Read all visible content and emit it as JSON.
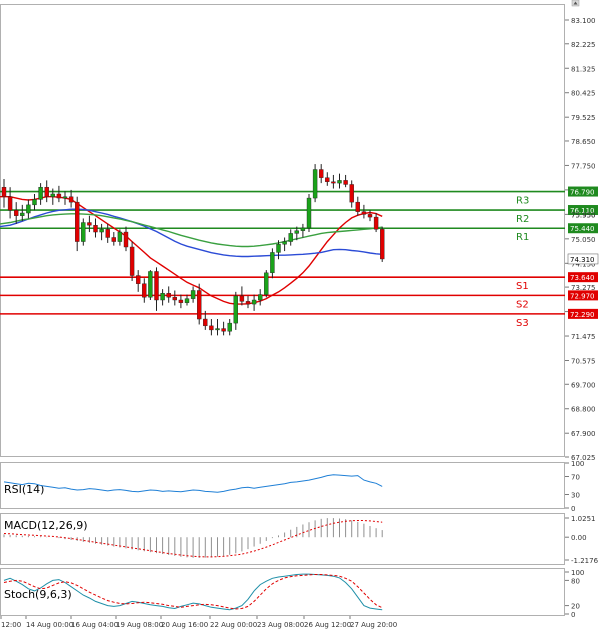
{
  "chart_data": [
    {
      "type": "candlestick",
      "panel": "price",
      "y_axis_ticks": [
        "83.100",
        "82.225",
        "81.325",
        "80.425",
        "79.525",
        "78.650",
        "77.750",
        "76.850",
        "75.950",
        "75.050",
        "74.150",
        "73.275",
        "72.375",
        "71.475",
        "70.575",
        "69.700",
        "68.800",
        "67.900",
        "67.025"
      ],
      "ylim": [
        67.025,
        83.1
      ],
      "x_tick_labels": [
        "12:00",
        "14 Aug 00:00",
        "16 Aug 04:00",
        "19 Aug 08:00",
        "20 Aug 16:00",
        "22 Aug 00:00",
        "23 Aug 08:00",
        "26 Aug 12:00",
        "27 Aug 20:00"
      ],
      "candles": [
        {
          "o": 76.95,
          "h": 77.25,
          "l": 76.2,
          "c": 76.6
        },
        {
          "o": 76.6,
          "h": 76.95,
          "l": 75.8,
          "c": 76.1
        },
        {
          "o": 76.1,
          "h": 76.4,
          "l": 75.6,
          "c": 75.9
        },
        {
          "o": 75.9,
          "h": 76.3,
          "l": 75.7,
          "c": 76.0
        },
        {
          "o": 76.0,
          "h": 76.5,
          "l": 75.8,
          "c": 76.3
        },
        {
          "o": 76.3,
          "h": 76.7,
          "l": 76.1,
          "c": 76.5
        },
        {
          "o": 76.5,
          "h": 77.1,
          "l": 76.3,
          "c": 76.95
        },
        {
          "o": 76.95,
          "h": 77.2,
          "l": 76.4,
          "c": 76.6
        },
        {
          "o": 76.6,
          "h": 76.9,
          "l": 76.3,
          "c": 76.7
        },
        {
          "o": 76.7,
          "h": 77.0,
          "l": 76.4,
          "c": 76.55
        },
        {
          "o": 76.55,
          "h": 76.8,
          "l": 76.3,
          "c": 76.6
        },
        {
          "o": 76.6,
          "h": 76.85,
          "l": 76.2,
          "c": 76.4
        },
        {
          "o": 76.4,
          "h": 76.6,
          "l": 74.6,
          "c": 74.95
        },
        {
          "o": 74.95,
          "h": 75.8,
          "l": 74.8,
          "c": 75.65
        },
        {
          "o": 75.65,
          "h": 75.9,
          "l": 75.3,
          "c": 75.55
        },
        {
          "o": 75.55,
          "h": 75.8,
          "l": 75.1,
          "c": 75.3
        },
        {
          "o": 75.3,
          "h": 75.6,
          "l": 75.0,
          "c": 75.4
        },
        {
          "o": 75.4,
          "h": 75.6,
          "l": 74.9,
          "c": 75.1
        },
        {
          "o": 75.1,
          "h": 75.3,
          "l": 74.8,
          "c": 74.95
        },
        {
          "o": 74.95,
          "h": 75.4,
          "l": 74.8,
          "c": 75.3
        },
        {
          "o": 75.3,
          "h": 75.5,
          "l": 74.6,
          "c": 74.75
        },
        {
          "o": 74.75,
          "h": 74.95,
          "l": 73.5,
          "c": 73.7
        },
        {
          "o": 73.7,
          "h": 73.9,
          "l": 73.1,
          "c": 73.4
        },
        {
          "o": 73.4,
          "h": 73.6,
          "l": 72.7,
          "c": 72.9
        },
        {
          "o": 72.9,
          "h": 73.9,
          "l": 72.8,
          "c": 73.85
        },
        {
          "o": 73.85,
          "h": 74.0,
          "l": 72.4,
          "c": 72.8
        },
        {
          "o": 72.8,
          "h": 73.2,
          "l": 72.6,
          "c": 73.05
        },
        {
          "o": 73.05,
          "h": 73.3,
          "l": 72.7,
          "c": 72.9
        },
        {
          "o": 72.9,
          "h": 73.15,
          "l": 72.6,
          "c": 72.8
        },
        {
          "o": 72.8,
          "h": 73.0,
          "l": 72.5,
          "c": 72.7
        },
        {
          "o": 72.7,
          "h": 73.0,
          "l": 72.6,
          "c": 72.85
        },
        {
          "o": 72.85,
          "h": 73.3,
          "l": 72.7,
          "c": 73.15
        },
        {
          "o": 73.15,
          "h": 73.4,
          "l": 71.9,
          "c": 72.1
        },
        {
          "o": 72.1,
          "h": 72.4,
          "l": 71.7,
          "c": 71.85
        },
        {
          "o": 71.85,
          "h": 72.1,
          "l": 71.5,
          "c": 71.7
        },
        {
          "o": 71.7,
          "h": 72.1,
          "l": 71.5,
          "c": 71.75
        },
        {
          "o": 71.75,
          "h": 72.0,
          "l": 71.5,
          "c": 71.65
        },
        {
          "o": 71.65,
          "h": 72.1,
          "l": 71.5,
          "c": 71.95
        },
        {
          "o": 71.95,
          "h": 73.1,
          "l": 71.7,
          "c": 72.95
        },
        {
          "o": 72.95,
          "h": 73.3,
          "l": 72.6,
          "c": 72.75
        },
        {
          "o": 72.75,
          "h": 72.95,
          "l": 72.5,
          "c": 72.65
        },
        {
          "o": 72.65,
          "h": 73.0,
          "l": 72.4,
          "c": 72.8
        },
        {
          "o": 72.8,
          "h": 73.2,
          "l": 72.6,
          "c": 73.0
        },
        {
          "o": 73.0,
          "h": 73.9,
          "l": 72.9,
          "c": 73.8
        },
        {
          "o": 73.8,
          "h": 74.7,
          "l": 73.6,
          "c": 74.55
        },
        {
          "o": 74.55,
          "h": 75.0,
          "l": 74.3,
          "c": 74.85
        },
        {
          "o": 74.85,
          "h": 75.1,
          "l": 74.6,
          "c": 74.95
        },
        {
          "o": 74.95,
          "h": 75.4,
          "l": 74.8,
          "c": 75.25
        },
        {
          "o": 75.25,
          "h": 75.5,
          "l": 75.0,
          "c": 75.35
        },
        {
          "o": 75.35,
          "h": 75.6,
          "l": 75.1,
          "c": 75.45
        },
        {
          "o": 75.45,
          "h": 76.7,
          "l": 75.3,
          "c": 76.55
        },
        {
          "o": 76.55,
          "h": 77.8,
          "l": 76.4,
          "c": 77.6
        },
        {
          "o": 77.6,
          "h": 77.8,
          "l": 77.1,
          "c": 77.3
        },
        {
          "o": 77.3,
          "h": 77.5,
          "l": 77.0,
          "c": 77.15
        },
        {
          "o": 77.15,
          "h": 77.4,
          "l": 76.9,
          "c": 77.1
        },
        {
          "o": 77.1,
          "h": 77.45,
          "l": 76.9,
          "c": 77.2
        },
        {
          "o": 77.2,
          "h": 77.4,
          "l": 76.95,
          "c": 77.05
        },
        {
          "o": 77.05,
          "h": 77.2,
          "l": 76.2,
          "c": 76.4
        },
        {
          "o": 76.4,
          "h": 76.6,
          "l": 75.9,
          "c": 76.05
        },
        {
          "o": 76.05,
          "h": 76.3,
          "l": 75.8,
          "c": 75.95
        },
        {
          "o": 75.95,
          "h": 76.1,
          "l": 75.7,
          "c": 75.85
        },
        {
          "o": 75.85,
          "h": 76.0,
          "l": 75.3,
          "c": 75.4
        },
        {
          "o": 75.4,
          "h": 75.5,
          "l": 74.2,
          "c": 74.31
        }
      ],
      "moving_averages": [
        {
          "color": "#e00000",
          "values": [
            76.6,
            76.6,
            76.55,
            76.5,
            76.48,
            76.5,
            76.55,
            76.6,
            76.6,
            76.58,
            76.55,
            76.5,
            76.35,
            76.2,
            76.05,
            75.9,
            75.75,
            75.6,
            75.45,
            75.3,
            75.15,
            74.95,
            74.75,
            74.55,
            74.35,
            74.2,
            74.05,
            73.9,
            73.75,
            73.6,
            73.45,
            73.35,
            73.25,
            73.1,
            72.95,
            72.85,
            72.75,
            72.68,
            72.65,
            72.65,
            72.66,
            72.7,
            72.76,
            72.85,
            72.98,
            73.1,
            73.25,
            73.42,
            73.6,
            73.8,
            74.05,
            74.35,
            74.65,
            74.95,
            75.2,
            75.45,
            75.65,
            75.82,
            75.92,
            75.98,
            76.02,
            75.98,
            75.88
          ]
        },
        {
          "color": "#2b4bd6",
          "values": [
            75.5,
            75.55,
            75.62,
            75.7,
            75.78,
            75.86,
            75.93,
            76.0,
            76.06,
            76.1,
            76.12,
            76.14,
            76.14,
            76.13,
            76.1,
            76.05,
            76.0,
            75.95,
            75.88,
            75.82,
            75.75,
            75.68,
            75.6,
            75.52,
            75.42,
            75.32,
            75.2,
            75.08,
            74.96,
            74.86,
            74.78,
            74.72,
            74.66,
            74.6,
            74.54,
            74.5,
            74.46,
            74.43,
            74.41,
            74.4,
            74.4,
            74.41,
            74.42,
            74.43,
            74.44,
            74.45,
            74.45,
            74.46,
            74.47,
            74.48,
            74.5,
            74.52,
            74.55,
            74.6,
            74.65,
            74.66,
            74.65,
            74.62,
            74.6,
            74.57,
            74.53,
            74.5,
            74.48
          ]
        },
        {
          "color": "#3aa040",
          "values": [
            75.6,
            75.65,
            75.7,
            75.75,
            75.78,
            75.82,
            75.86,
            75.9,
            75.93,
            75.95,
            75.96,
            75.97,
            75.97,
            75.96,
            75.95,
            75.93,
            75.9,
            75.86,
            75.82,
            75.78,
            75.73,
            75.68,
            75.62,
            75.56,
            75.5,
            75.44,
            75.38,
            75.32,
            75.25,
            75.18,
            75.12,
            75.06,
            75.0,
            74.95,
            74.9,
            74.86,
            74.83,
            74.8,
            74.78,
            74.77,
            74.77,
            74.78,
            74.8,
            74.83,
            74.86,
            74.9,
            74.95,
            75.0,
            75.05,
            75.1,
            75.15,
            75.2,
            75.25,
            75.28,
            75.3,
            75.32,
            75.34,
            75.36,
            75.38,
            75.4,
            75.42,
            75.45,
            75.48
          ]
        }
      ],
      "levels": [
        {
          "name": "R3",
          "value": "76.790",
          "v": 76.79,
          "color": "#1f8a1f"
        },
        {
          "name": "R2",
          "value": "76.110",
          "v": 76.11,
          "color": "#1f8a1f"
        },
        {
          "name": "R1",
          "value": "75.440",
          "v": 75.44,
          "color": "#1f8a1f"
        },
        {
          "name": "S1",
          "value": "73.640",
          "v": 73.64,
          "color": "#e00000"
        },
        {
          "name": "S2",
          "value": "72.970",
          "v": 72.97,
          "color": "#e00000"
        },
        {
          "name": "S3",
          "value": "72.290",
          "v": 72.29,
          "color": "#e00000"
        }
      ],
      "current_price": {
        "value": "74.310",
        "v": 74.31
      },
      "hidden_tick": {
        "label": "75.950",
        "v": 75.95
      }
    },
    {
      "type": "line",
      "panel": "rsi",
      "label": "RSI(14)",
      "y_axis_ticks": [
        "100",
        "70",
        "30",
        "0"
      ],
      "ylim": [
        0,
        100
      ],
      "color": "#1e7fd6",
      "values": [
        58,
        56,
        54,
        52,
        55,
        54,
        50,
        48,
        46,
        44,
        45,
        42,
        40,
        41,
        43,
        42,
        40,
        38,
        40,
        41,
        39,
        37,
        36,
        38,
        40,
        39,
        37,
        38,
        37,
        36,
        38,
        40,
        39,
        37,
        36,
        35,
        37,
        40,
        42,
        45,
        46,
        44,
        46,
        48,
        50,
        52,
        54,
        57,
        58,
        60,
        62,
        65,
        68,
        72,
        74,
        73,
        72,
        71,
        72,
        62,
        58,
        55,
        48
      ]
    },
    {
      "type": "bar",
      "panel": "macd",
      "label": "MACD(12,26,9)",
      "y_axis_ticks": [
        "1.0251",
        "0.00",
        "-1.2176"
      ],
      "ylim": [
        -1.2176,
        1.0251
      ],
      "bar_color": "#909090",
      "signal_color": "#e00000",
      "histogram": [
        0.15,
        0.12,
        0.1,
        0.08,
        0.06,
        0.05,
        0.04,
        0.02,
        0.0,
        -0.05,
        -0.1,
        -0.15,
        -0.2,
        -0.25,
        -0.3,
        -0.35,
        -0.4,
        -0.45,
        -0.5,
        -0.55,
        -0.6,
        -0.65,
        -0.7,
        -0.75,
        -0.8,
        -0.85,
        -0.9,
        -0.95,
        -1.0,
        -1.05,
        -1.08,
        -1.1,
        -1.1,
        -1.09,
        -1.07,
        -1.04,
        -1.0,
        -0.94,
        -0.86,
        -0.76,
        -0.64,
        -0.5,
        -0.35,
        -0.2,
        -0.05,
        0.1,
        0.25,
        0.4,
        0.55,
        0.68,
        0.8,
        0.9,
        0.98,
        1.02,
        1.02,
        1.0,
        0.96,
        0.9,
        0.82,
        0.72,
        0.6,
        0.48,
        0.38
      ],
      "signal": [
        0.2,
        0.18,
        0.16,
        0.14,
        0.12,
        0.1,
        0.08,
        0.06,
        0.04,
        0.01,
        -0.03,
        -0.07,
        -0.12,
        -0.17,
        -0.22,
        -0.27,
        -0.32,
        -0.37,
        -0.42,
        -0.47,
        -0.52,
        -0.57,
        -0.62,
        -0.67,
        -0.72,
        -0.77,
        -0.82,
        -0.87,
        -0.91,
        -0.95,
        -0.99,
        -1.02,
        -1.04,
        -1.05,
        -1.05,
        -1.04,
        -1.02,
        -0.99,
        -0.95,
        -0.9,
        -0.83,
        -0.74,
        -0.64,
        -0.53,
        -0.41,
        -0.28,
        -0.15,
        -0.02,
        0.11,
        0.24,
        0.36,
        0.47,
        0.57,
        0.66,
        0.74,
        0.8,
        0.85,
        0.88,
        0.89,
        0.89,
        0.87,
        0.84,
        0.8
      ]
    },
    {
      "type": "line",
      "panel": "stochastic",
      "label": "Stoch(9,6,3)",
      "y_axis_ticks": [
        "100",
        "80",
        "20",
        "0"
      ],
      "ylim": [
        0,
        100
      ],
      "k_color": "#1e8fa8",
      "d_color": "#e00000",
      "k": [
        80,
        85,
        78,
        70,
        60,
        55,
        62,
        72,
        80,
        82,
        75,
        65,
        55,
        45,
        38,
        30,
        25,
        20,
        18,
        20,
        25,
        30,
        28,
        25,
        22,
        20,
        18,
        15,
        13,
        18,
        22,
        26,
        24,
        20,
        16,
        14,
        12,
        10,
        14,
        20,
        35,
        55,
        70,
        78,
        85,
        88,
        90,
        92,
        94,
        95,
        95,
        94,
        93,
        92,
        90,
        86,
        75,
        60,
        40,
        20,
        14,
        12,
        10
      ],
      "d": [
        75,
        78,
        80,
        78,
        72,
        65,
        60,
        62,
        68,
        74,
        77,
        74,
        68,
        60,
        52,
        45,
        38,
        32,
        28,
        25,
        24,
        25,
        27,
        28,
        27,
        25,
        23,
        20,
        18,
        16,
        18,
        20,
        22,
        23,
        22,
        20,
        17,
        14,
        12,
        13,
        18,
        30,
        45,
        60,
        72,
        80,
        86,
        89,
        91,
        92,
        93,
        94,
        94,
        93,
        92,
        90,
        85,
        78,
        65,
        50,
        35,
        22,
        15
      ]
    }
  ]
}
